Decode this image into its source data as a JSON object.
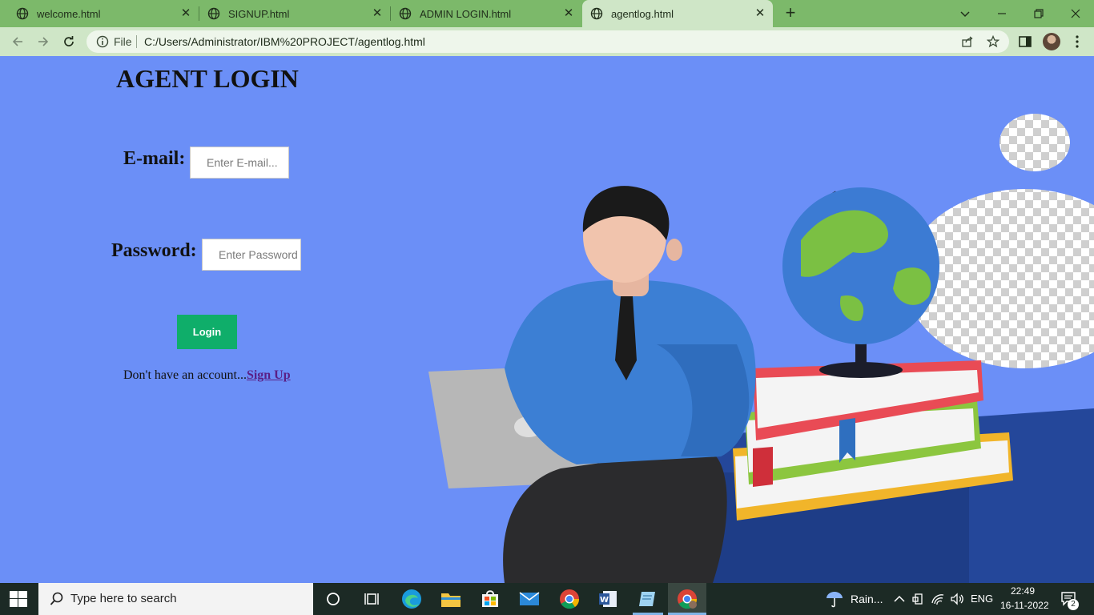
{
  "browser": {
    "tabs": [
      {
        "title": "welcome.html",
        "active": false
      },
      {
        "title": "SIGNUP.html",
        "active": false
      },
      {
        "title": "ADMIN LOGIN.html",
        "active": false
      },
      {
        "title": "agentlog.html",
        "active": true
      }
    ],
    "address": {
      "scheme_label": "File",
      "url": "C:/Users/Administrator/IBM%20PROJECT/agentlog.html"
    }
  },
  "page": {
    "title": "AGENT LOGIN",
    "email_label": "E-mail:",
    "email_placeholder": "Enter E-mail...",
    "password_label": "Password:",
    "password_placeholder": "Enter Password",
    "login_label": "Login",
    "signup_prompt": "Don't have an account...",
    "signup_link": "Sign Up"
  },
  "taskbar": {
    "search_placeholder": "Type here to search",
    "weather": "Rain...",
    "language": "ENG",
    "time": "22:49",
    "date": "16-11-2022",
    "notification_count": "2"
  },
  "colors": {
    "page_background": "#6b8ff7",
    "tab_strip": "#7cb96a",
    "login_button": "#0fae6a",
    "signup_link": "#5a1f86"
  }
}
